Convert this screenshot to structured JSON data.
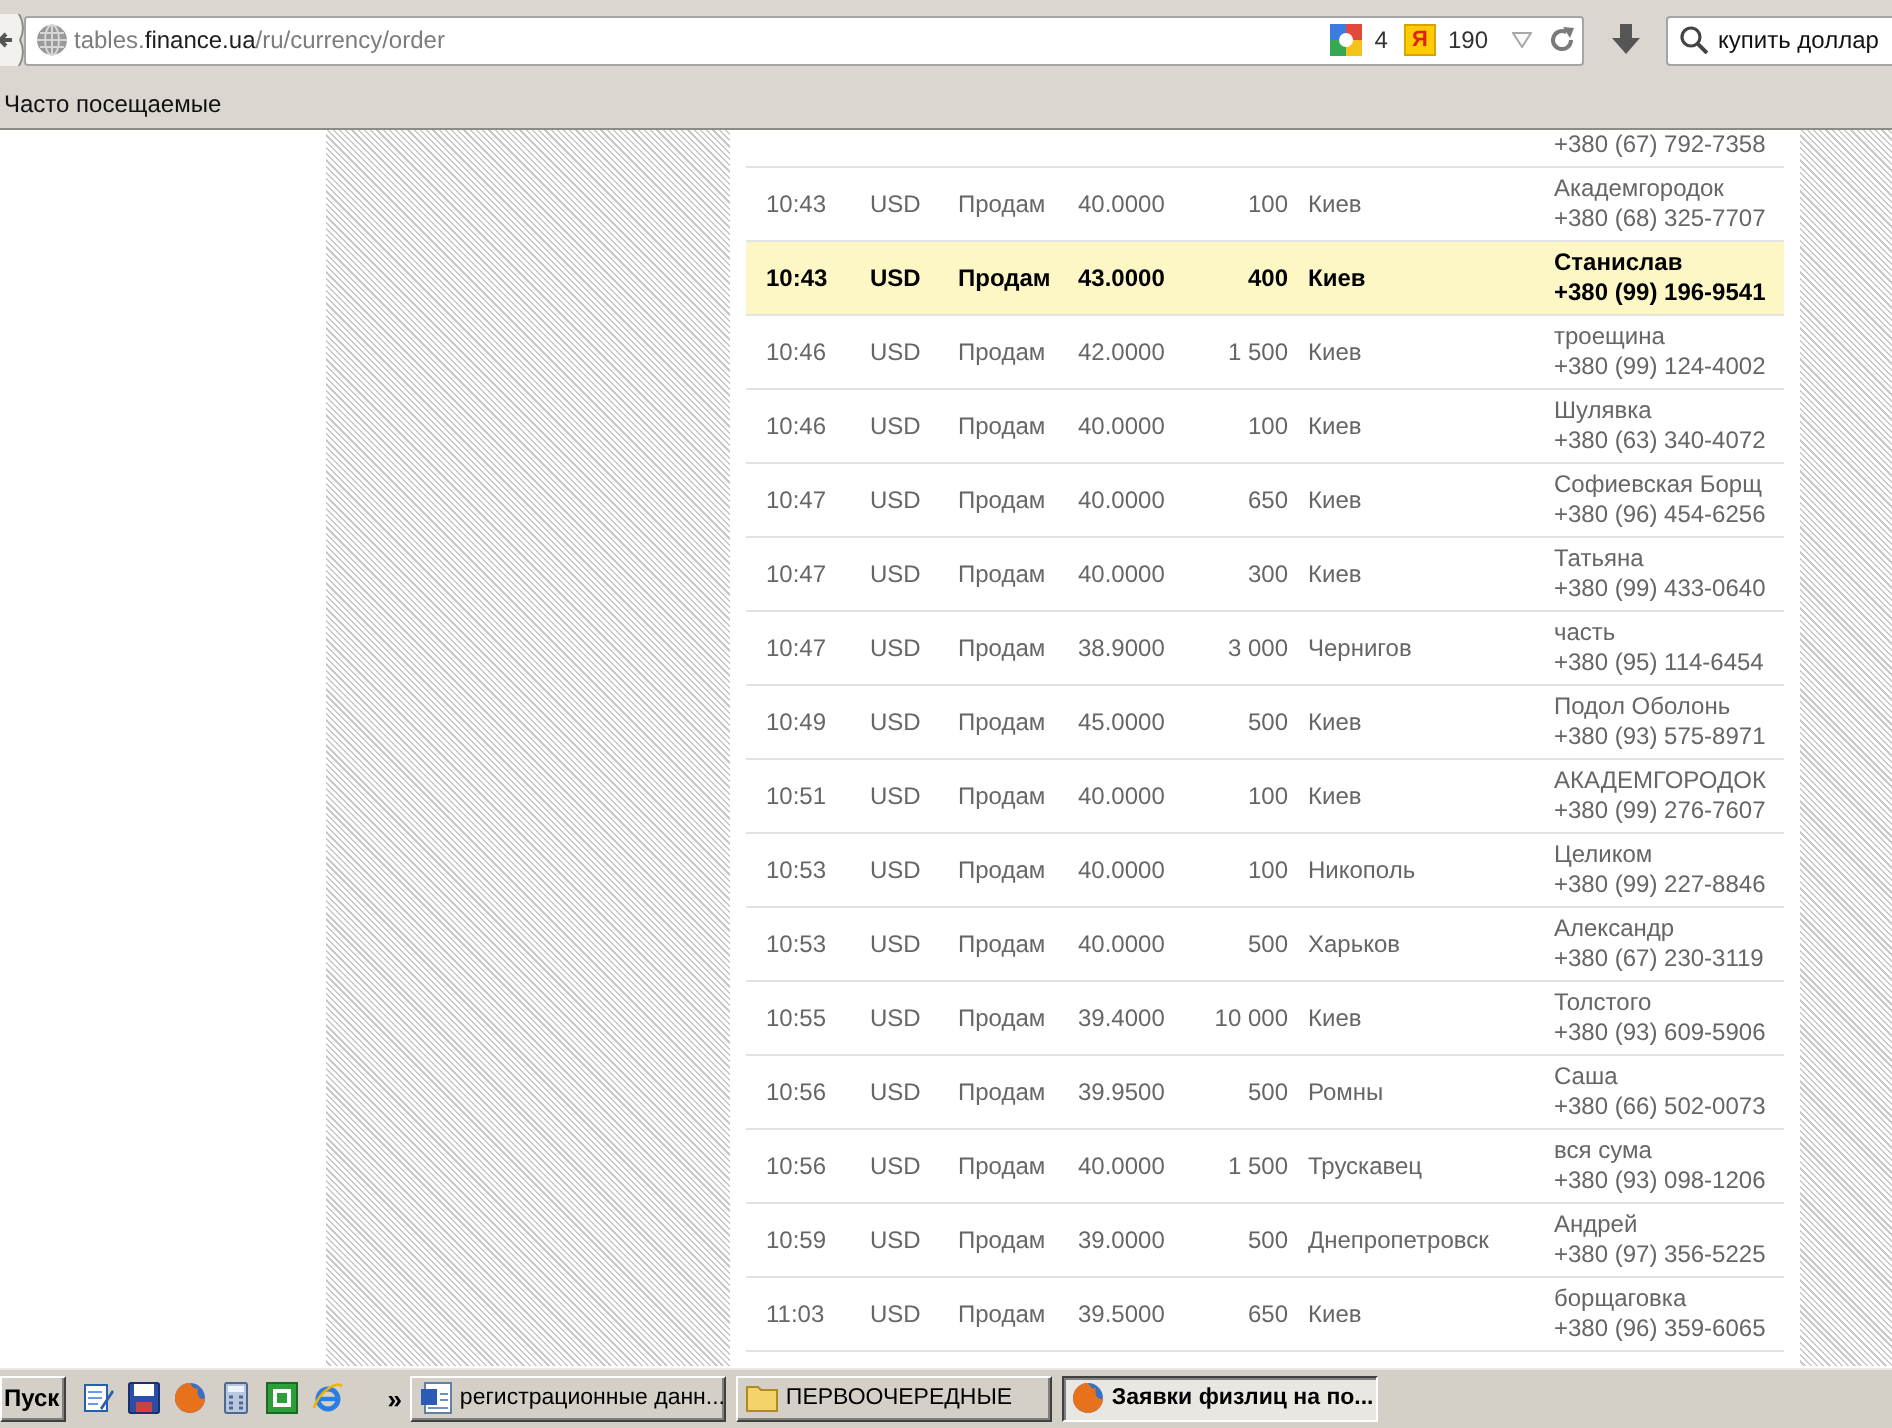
{
  "browser": {
    "url": "tables.**finance.ua**/ru/currency/order",
    "badges": [
      {
        "kind": "squares",
        "count": "4"
      },
      {
        "kind": "letter",
        "glyph": "Я",
        "count": "190"
      }
    ],
    "search": {
      "value": "купить доллар"
    }
  },
  "bookmarks_bar": {
    "items": [
      {
        "label": "Часто посещаемые"
      }
    ]
  },
  "table": {
    "rows": [
      {
        "phone": "+380 (67) 792-7358",
        "highlighted": false
      },
      {
        "time": "10:43",
        "currency": "USD",
        "action": "Продам",
        "rate": "40.0000",
        "amount": "100",
        "city": "Киев",
        "note": "Академгородок",
        "phone": "+380 (68) 325-7707",
        "highlighted": false
      },
      {
        "time": "10:43",
        "currency": "USD",
        "action": "Продам",
        "rate": "43.0000",
        "amount": "400",
        "city": "Киев",
        "note": "Станислав",
        "phone": "+380 (99) 196-9541",
        "highlighted": true
      },
      {
        "time": "10:46",
        "currency": "USD",
        "action": "Продам",
        "rate": "42.0000",
        "amount": "1 500",
        "city": "Киев",
        "note": "троещина",
        "phone": "+380 (99) 124-4002",
        "highlighted": false
      },
      {
        "time": "10:46",
        "currency": "USD",
        "action": "Продам",
        "rate": "40.0000",
        "amount": "100",
        "city": "Киев",
        "note": "Шулявка",
        "phone": "+380 (63) 340-4072",
        "highlighted": false
      },
      {
        "time": "10:47",
        "currency": "USD",
        "action": "Продам",
        "rate": "40.0000",
        "amount": "650",
        "city": "Киев",
        "note": "Софиевская Борщ",
        "phone": "+380 (96) 454-6256",
        "highlighted": false
      },
      {
        "time": "10:47",
        "currency": "USD",
        "action": "Продам",
        "rate": "40.0000",
        "amount": "300",
        "city": "Киев",
        "note": "Татьяна",
        "phone": "+380 (99) 433-0640",
        "highlighted": false
      },
      {
        "time": "10:47",
        "currency": "USD",
        "action": "Продам",
        "rate": "38.9000",
        "amount": "3 000",
        "city": "Чернигов",
        "note": "часть",
        "phone": "+380 (95) 114-6454",
        "highlighted": false
      },
      {
        "time": "10:49",
        "currency": "USD",
        "action": "Продам",
        "rate": "45.0000",
        "amount": "500",
        "city": "Киев",
        "note": "Подол Оболонь",
        "phone": "+380 (93) 575-8971",
        "highlighted": false
      },
      {
        "time": "10:51",
        "currency": "USD",
        "action": "Продам",
        "rate": "40.0000",
        "amount": "100",
        "city": "Киев",
        "note": "АКАДЕМГОРОДОК",
        "phone": "+380 (99) 276-7607",
        "highlighted": false
      },
      {
        "time": "10:53",
        "currency": "USD",
        "action": "Продам",
        "rate": "40.0000",
        "amount": "100",
        "city": "Никополь",
        "note": "Целиком",
        "phone": "+380 (99) 227-8846",
        "highlighted": false
      },
      {
        "time": "10:53",
        "currency": "USD",
        "action": "Продам",
        "rate": "40.0000",
        "amount": "500",
        "city": "Харьков",
        "note": "Александр",
        "phone": "+380 (67) 230-3119",
        "highlighted": false
      },
      {
        "time": "10:55",
        "currency": "USD",
        "action": "Продам",
        "rate": "39.4000",
        "amount": "10 000",
        "city": "Киев",
        "note": "Толстого",
        "phone": "+380 (93) 609-5906",
        "highlighted": false
      },
      {
        "time": "10:56",
        "currency": "USD",
        "action": "Продам",
        "rate": "39.9500",
        "amount": "500",
        "city": "Ромны",
        "note": "Саша",
        "phone": "+380 (66) 502-0073",
        "highlighted": false
      },
      {
        "time": "10:56",
        "currency": "USD",
        "action": "Продам",
        "rate": "40.0000",
        "amount": "1 500",
        "city": "Трускавец",
        "note": "вся сума",
        "phone": "+380 (93) 098-1206",
        "highlighted": false
      },
      {
        "time": "10:59",
        "currency": "USD",
        "action": "Продам",
        "rate": "39.0000",
        "amount": "500",
        "city": "Днепропетровск",
        "note": "Андрей",
        "phone": "+380 (97) 356-5225",
        "highlighted": false
      },
      {
        "time": "11:03",
        "currency": "USD",
        "action": "Продам",
        "rate": "39.5000",
        "amount": "650",
        "city": "Киев",
        "note": "борщаговка",
        "phone": "+380 (96) 359-6065",
        "highlighted": false
      }
    ]
  },
  "taskbar": {
    "start": "Пуск",
    "overflow": "»",
    "tasks": [
      {
        "kind": "document",
        "label": "регистрационные данн...",
        "selected": false
      },
      {
        "kind": "folder",
        "label": "ПЕРВООЧЕРЕДНЫЕ",
        "selected": false
      },
      {
        "kind": "browser",
        "label": "Заявки физлиц на по...",
        "selected": true
      }
    ]
  }
}
